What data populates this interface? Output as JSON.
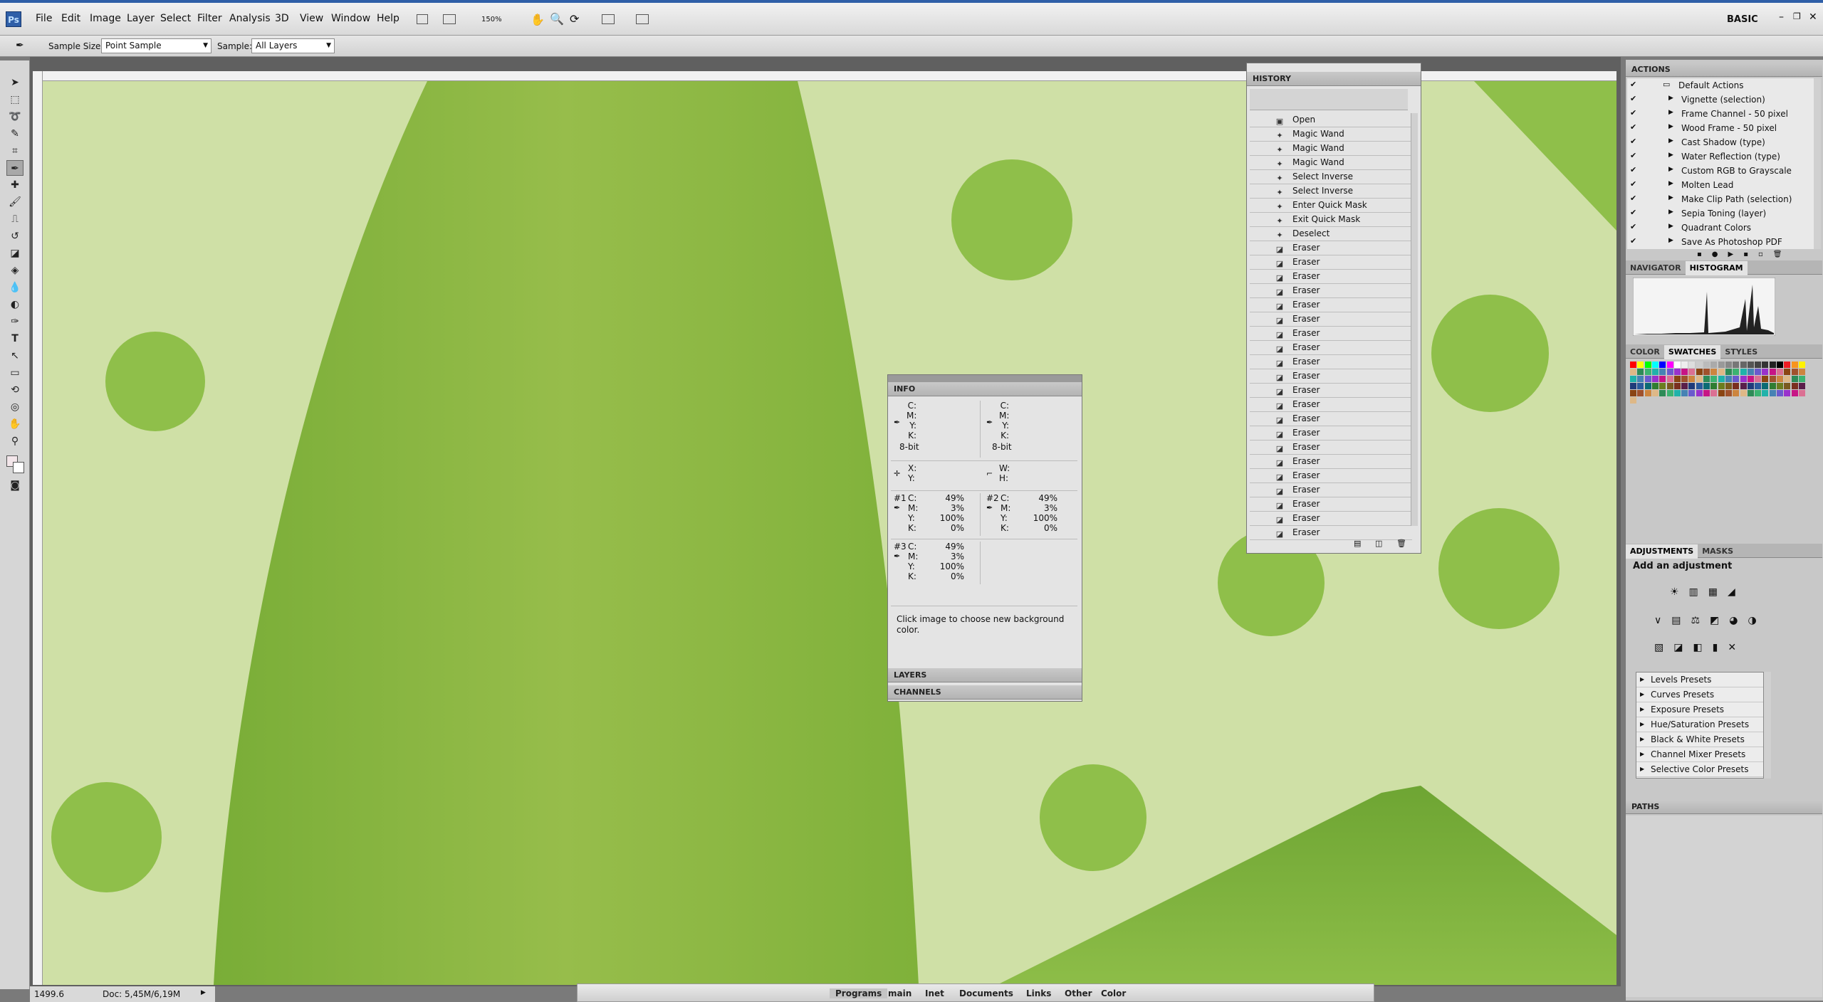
{
  "app": {
    "logo": "Ps",
    "workspace": "BASIC",
    "zoom_select": "150%"
  },
  "menu": [
    "File",
    "Edit",
    "Image",
    "Layer",
    "Select",
    "Filter",
    "Analysis",
    "3D",
    "View",
    "Window",
    "Help"
  ],
  "options_bar": {
    "sample_size_label": "Sample Size:",
    "sample_size_value": "Point Sample",
    "sample_label": "Sample:",
    "sample_value": "All Layers"
  },
  "history": {
    "title": "HISTORY",
    "items": [
      "Open",
      "Magic Wand",
      "Magic Wand",
      "Magic Wand",
      "Select Inverse",
      "Select Inverse",
      "Enter Quick Mask",
      "Exit Quick Mask",
      "Deselect",
      "Eraser",
      "Eraser",
      "Eraser",
      "Eraser",
      "Eraser",
      "Eraser",
      "Eraser",
      "Eraser",
      "Eraser",
      "Eraser",
      "Eraser",
      "Eraser",
      "Eraser",
      "Eraser",
      "Eraser",
      "Eraser",
      "Eraser",
      "Eraser",
      "Eraser",
      "Eraser",
      "Eraser"
    ]
  },
  "info": {
    "title": "INFO",
    "cmyk_labels": [
      "C:",
      "M:",
      "Y:",
      "K:"
    ],
    "bit_depth": "8-bit",
    "xy_labels": [
      "X:",
      "Y:"
    ],
    "wh_labels": [
      "W:",
      "H:"
    ],
    "samplers": [
      {
        "label": "#1",
        "c": "49%",
        "m": "3%",
        "y": "100%",
        "k": "0%"
      },
      {
        "label": "#2",
        "c": "49%",
        "m": "3%",
        "y": "100%",
        "k": "0%"
      },
      {
        "label": "#3",
        "c": "49%",
        "m": "3%",
        "y": "100%",
        "k": "0%"
      }
    ],
    "hint": "Click image to choose new background color."
  },
  "layers_tab": "LAYERS",
  "channels_tab": "CHANNELS",
  "actions": {
    "title": "ACTIONS",
    "set": "Default Actions",
    "items": [
      "Vignette (selection)",
      "Frame Channel - 50 pixel",
      "Wood Frame - 50 pixel",
      "Cast Shadow (type)",
      "Water Reflection (type)",
      "Custom RGB to Grayscale",
      "Molten Lead",
      "Make Clip Path (selection)",
      "Sepia Toning (layer)",
      "Quadrant Colors",
      "Save As Photoshop PDF"
    ]
  },
  "navigator_tabs": [
    "NAVIGATOR",
    "HISTOGRAM"
  ],
  "color_tabs": [
    "COLOR",
    "SWATCHES",
    "STYLES"
  ],
  "adjustments": {
    "tabs": [
      "ADJUSTMENTS",
      "MASKS"
    ],
    "heading": "Add an adjustment",
    "presets": [
      "Levels Presets",
      "Curves Presets",
      "Exposure Presets",
      "Hue/Saturation Presets",
      "Black & White Presets",
      "Channel Mixer Presets",
      "Selective Color Presets"
    ]
  },
  "paths_tab": "PATHS",
  "status": {
    "zoom": "1499.6",
    "doc": "Doc: 5,45M/6,19M"
  },
  "taskbar": [
    "Programs",
    "main",
    "Inet",
    "Documents",
    "Links",
    "Other",
    "Color"
  ],
  "colors": {
    "image_light": "#cfe0a6",
    "image_green": "#8fbf4a",
    "accent": "#2f5fa8"
  }
}
